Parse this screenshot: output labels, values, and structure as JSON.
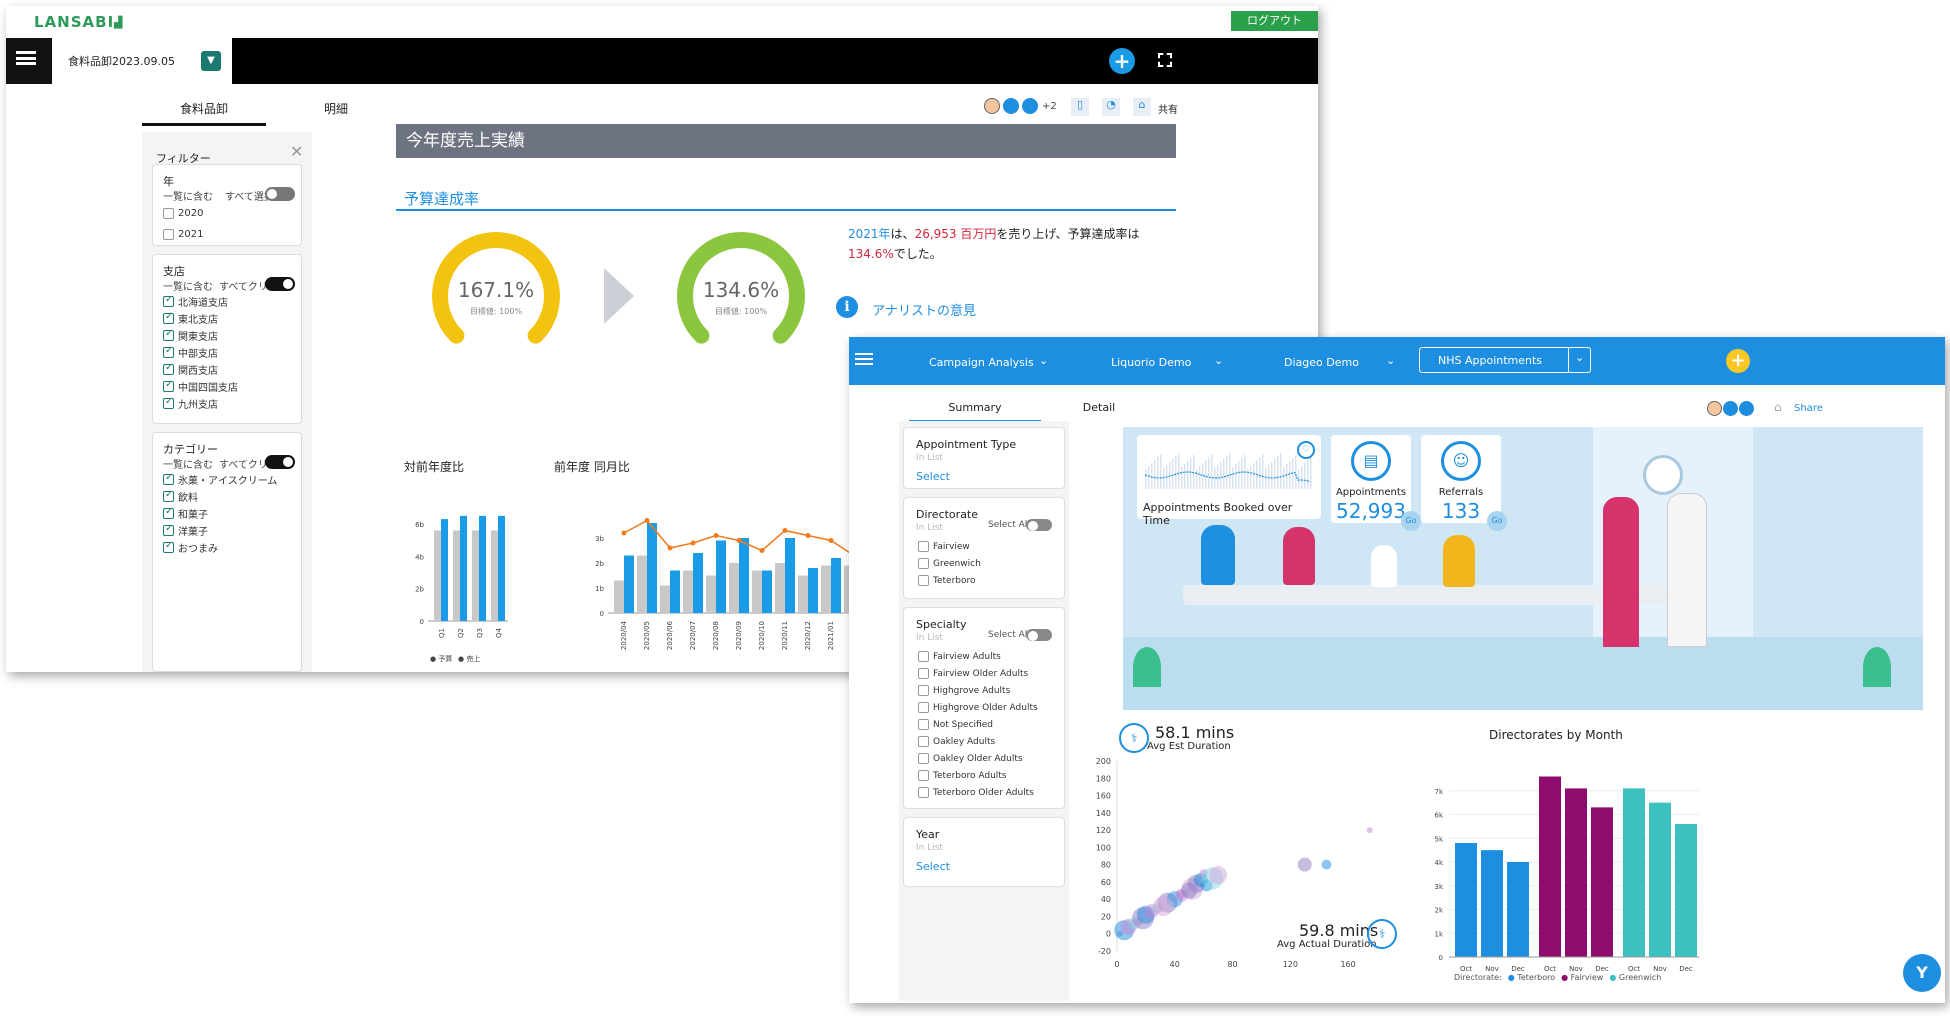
{
  "win1": {
    "logo": "LANSABI",
    "logout": "ログアウト",
    "tab_title": "食料品卸2023.09.05",
    "subtabs": [
      "食料品卸",
      "明細"
    ],
    "collab_count": "+2",
    "share": "共有",
    "filter_title": "フィルター",
    "year": {
      "title": "年",
      "mode": "一覧に含む",
      "action": "すべて選択",
      "items": [
        "2020",
        "2021"
      ]
    },
    "branch": {
      "title": "支店",
      "mode": "一覧に含む",
      "action": "すべてクリア",
      "items": [
        "北海道支店",
        "東北支店",
        "関東支店",
        "中部支店",
        "関西支店",
        "中国四国支店",
        "九州支店"
      ]
    },
    "category": {
      "title": "カテゴリー",
      "mode": "一覧に含む",
      "action": "すべてクリア",
      "items": [
        "氷菓・アイスクリーム",
        "飲料",
        "和菓子",
        "洋菓子",
        "おつまみ"
      ]
    },
    "banner": "今年度売上実績",
    "section": "予算達成率",
    "gauge1": {
      "value": "167.1%",
      "target": "目標値: 100%",
      "pct": 1.0
    },
    "gauge2": {
      "value": "134.6%",
      "target": "目標値: 100%",
      "pct": 1.0
    },
    "summary": {
      "p1": "2021年",
      "p2": "は、",
      "p3": "26,953 百万円",
      "p4": "を売り上げ、予算達成率は",
      "p5": "134.6%",
      "p6": "でした。"
    },
    "analyst": "アナリストの意見",
    "chart_titles": [
      "対前年度比",
      "前年度 同月比"
    ],
    "colors": {
      "accent": "#1a7a70",
      "gauge_yellow": "#f2c311",
      "gauge_green": "#8cc63f",
      "bar_blue": "#1a9be6",
      "bar_gray": "#c8c8c8",
      "line_orange": "#f07b1e"
    }
  },
  "chart_data": [
    {
      "type": "bar",
      "title": "対前年度比",
      "categories": [
        "Q1",
        "Q2",
        "Q3",
        "Q4"
      ],
      "series": [
        {
          "name": "予算",
          "values": [
            5.6,
            5.6,
            5.6,
            5.6
          ]
        },
        {
          "name": "売上",
          "values": [
            6.3,
            6.5,
            6.5,
            6.5
          ]
        }
      ],
      "yticks": [
        "0",
        "2b",
        "4b",
        "6b"
      ],
      "ylim": [
        0,
        6.8
      ],
      "legend": [
        "予算",
        "売上"
      ]
    },
    {
      "type": "bar",
      "title": "前年度 同月比",
      "categories": [
        "2020/04",
        "2020/05",
        "2020/06",
        "2020/07",
        "2020/08",
        "2020/09",
        "2020/10",
        "2020/11",
        "2020/12",
        "2021/01",
        "2021/02"
      ],
      "series": [
        {
          "name": "gray",
          "values": [
            1.3,
            2.3,
            1.1,
            1.7,
            1.5,
            2.0,
            1.7,
            2.0,
            1.5,
            1.9,
            1.9
          ]
        },
        {
          "name": "blue",
          "values": [
            2.3,
            3.6,
            1.7,
            2.4,
            2.9,
            3.0,
            1.7,
            3.0,
            1.8,
            2.2,
            2.5
          ]
        },
        {
          "name": "line",
          "values": [
            3.2,
            3.7,
            2.6,
            2.8,
            3.1,
            2.9,
            2.5,
            3.3,
            3.1,
            2.9,
            2.3
          ]
        }
      ],
      "yticks": [
        "0",
        "1b",
        "2b",
        "3b"
      ],
      "ylim": [
        0,
        4
      ]
    },
    {
      "type": "scatter",
      "title": "",
      "xticks": [
        "0",
        "40",
        "80",
        "120",
        "160"
      ],
      "yticks": [
        "200",
        "180",
        "160",
        "140",
        "120",
        "100",
        "80",
        "60",
        "40",
        "20",
        "0",
        "-20"
      ],
      "points": [
        [
          2,
          0
        ],
        [
          5,
          4
        ],
        [
          8,
          8
        ],
        [
          12,
          12
        ],
        [
          15,
          14
        ],
        [
          18,
          18
        ],
        [
          20,
          22
        ],
        [
          24,
          26
        ],
        [
          28,
          30
        ],
        [
          30,
          28
        ],
        [
          35,
          36
        ],
        [
          40,
          40
        ],
        [
          45,
          44
        ],
        [
          48,
          48
        ],
        [
          52,
          52
        ],
        [
          55,
          58
        ],
        [
          58,
          62
        ],
        [
          44,
          46
        ],
        [
          38,
          34
        ],
        [
          32,
          32
        ],
        [
          50,
          50
        ],
        [
          62,
          56
        ],
        [
          60,
          70
        ],
        [
          66,
          64
        ],
        [
          70,
          68
        ],
        [
          130,
          80
        ],
        [
          145,
          80
        ],
        [
          175,
          120
        ]
      ]
    },
    {
      "type": "bar",
      "title": "Directorates by Month",
      "categories": [
        "Oct",
        "Nov",
        "Dec",
        "Oct",
        "Nov",
        "Dec",
        "Oct",
        "Nov",
        "Dec"
      ],
      "values": [
        4800,
        4500,
        4000,
        7600,
        7100,
        6300,
        7100,
        6500,
        5600
      ],
      "groups": [
        "Teterboro",
        "Fairview",
        "Greenwich"
      ],
      "yticks": [
        "0",
        "1k",
        "2k",
        "3k",
        "4k",
        "5k",
        "6k",
        "7k"
      ],
      "ylim": [
        0,
        8000
      ],
      "legend_label": "Directorate:"
    }
  ],
  "win2": {
    "nav": [
      "Campaign Analysis",
      "Liquorio Demo",
      "Diageo Demo",
      "NHS Appointments"
    ],
    "subtabs": [
      "Summary",
      "Detail"
    ],
    "share": "Share",
    "appt_type": {
      "title": "Appointment Type",
      "mode": "In List",
      "select": "Select"
    },
    "directorate": {
      "title": "Directorate",
      "mode": "In List",
      "select_all": "Select All",
      "items": [
        "Fairview",
        "Greenwich",
        "Teterboro"
      ]
    },
    "specialty": {
      "title": "Specialty",
      "mode": "In List",
      "select_all": "Select All",
      "items": [
        "Fairview Adults",
        "Fairview Older Adults",
        "Highgrove Adults",
        "Highgrove Older Adults",
        "Not Specified",
        "Oakley Adults",
        "Oakley Older Adults",
        "Teterboro Adults",
        "Teterboro Older Adults"
      ]
    },
    "year": {
      "title": "Year",
      "mode": "In List",
      "select": "Select"
    },
    "booked_title": "Appointments Booked over Time",
    "kpi1": {
      "label": "Appointments",
      "value": "52,993",
      "go": "Go"
    },
    "kpi2": {
      "label": "Referrals",
      "value": "133",
      "go": "Go"
    },
    "est": {
      "value": "58.1 mins",
      "label": "Avg Est Duration"
    },
    "act": {
      "value": "59.8 mins",
      "label": "Avg Actual Duration"
    },
    "dir_title": "Directorates by Month",
    "legend": [
      "Directorate:",
      "Teterboro",
      "Fairview",
      "Greenwich"
    ],
    "colors": {
      "blue": "#1e8ee0",
      "purple": "#8e0c6e",
      "teal": "#3cc1c0",
      "yellow": "#f9c825"
    }
  }
}
